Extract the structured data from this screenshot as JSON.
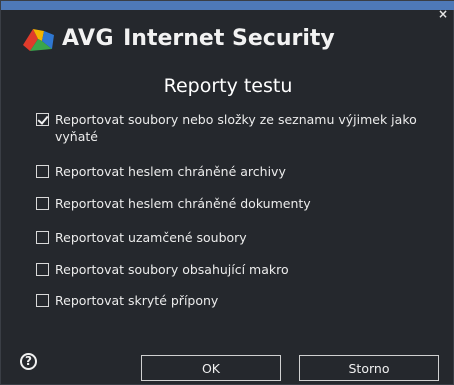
{
  "app": {
    "brand": "AVG",
    "product": "Internet Security"
  },
  "dialog": {
    "title": "Reporty testu"
  },
  "options": [
    {
      "label": "Reportovat soubory nebo složky ze seznamu výjimek jako vyňaté",
      "checked": true
    },
    {
      "label": "Reportovat heslem chráněné archivy",
      "checked": false
    },
    {
      "label": "Reportovat heslem chráněné dokumenty",
      "checked": false
    },
    {
      "label": "Reportovat uzamčené soubory",
      "checked": false
    },
    {
      "label": "Reportovat soubory obsahující makro",
      "checked": false
    },
    {
      "label": "Reportovat skryté přípony",
      "checked": false
    }
  ],
  "buttons": {
    "ok": "OK",
    "cancel": "Storno",
    "help": "?",
    "close": "×"
  },
  "icons": {
    "logo": "avg-logo-icon",
    "help": "help-icon",
    "close": "close-icon"
  },
  "colors": {
    "background": "#25282d",
    "accent": "#4e79b8",
    "text": "#ececec"
  }
}
